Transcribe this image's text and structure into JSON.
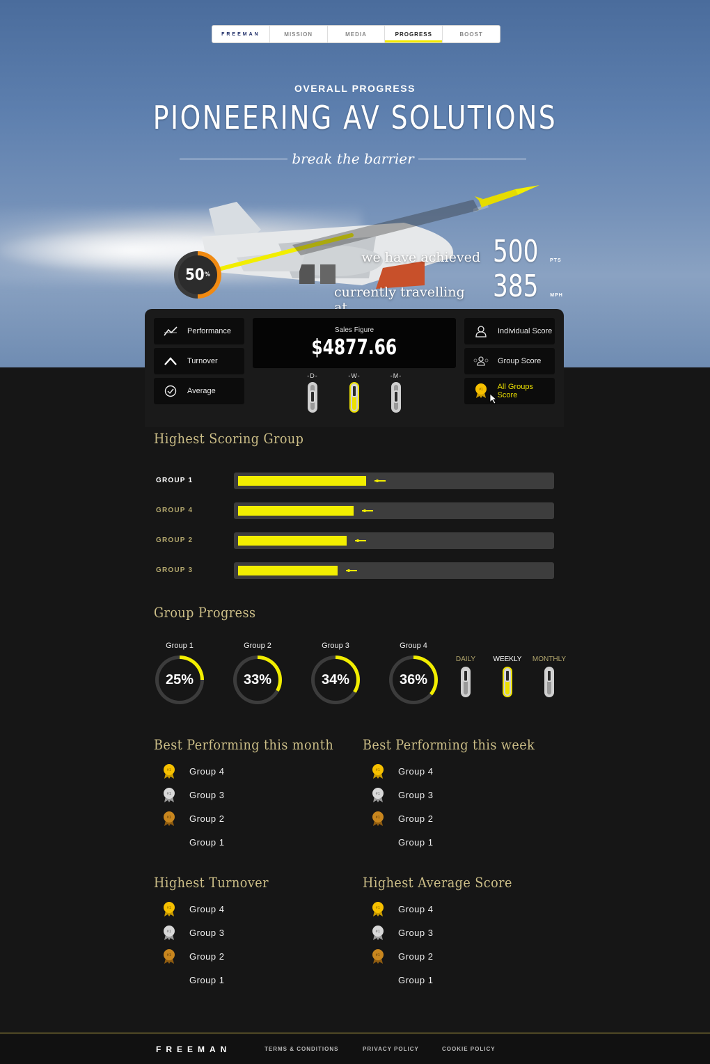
{
  "nav": {
    "brand": "FREEMAN",
    "items": [
      "MISSION",
      "MEDIA",
      "PROGRESS",
      "BOOST"
    ],
    "active": "PROGRESS"
  },
  "hero": {
    "eyebrow": "OVERALL PROGRESS",
    "headline": "PIONEERING AV SOLUTIONS",
    "tagline": "break the barrier",
    "progress_percent": "50",
    "progress_unit": "%",
    "achieved_label": "we have achieved",
    "achieved_value": "500",
    "achieved_unit": "PTS",
    "travelling_label": "currently travelling at",
    "travelling_value": "385",
    "travelling_unit": "MPH"
  },
  "panel": {
    "left_buttons": [
      "Performance",
      "Turnover",
      "Average"
    ],
    "right_buttons": [
      "Individual Score",
      "Group Score",
      "All Groups Score"
    ],
    "sales_label": "Sales Figure",
    "sales_value": "$4877.66",
    "toggles": [
      {
        "label": "-D-",
        "on": false
      },
      {
        "label": "-W-",
        "on": true
      },
      {
        "label": "-M-",
        "on": false
      }
    ],
    "medal_text": "#1"
  },
  "highest_scoring": {
    "title": "Highest Scoring Group",
    "groups": [
      {
        "label": "GROUP 1",
        "fill": 0.4
      },
      {
        "label": "GROUP 4",
        "fill": 0.36
      },
      {
        "label": "GROUP 2",
        "fill": 0.34
      },
      {
        "label": "GROUP 3",
        "fill": 0.31
      }
    ]
  },
  "group_progress": {
    "title": "Group Progress",
    "groups": [
      {
        "label": "Group 1",
        "value": "25%",
        "percent": 25
      },
      {
        "label": "Group 2",
        "value": "33%",
        "percent": 33
      },
      {
        "label": "Group 3",
        "value": "34%",
        "percent": 34
      },
      {
        "label": "Group 4",
        "value": "36%",
        "percent": 36
      }
    ],
    "periods": [
      {
        "label": "DAILY",
        "on": false
      },
      {
        "label": "WEEKLY",
        "on": true
      },
      {
        "label": "MONTHLY",
        "on": false
      }
    ]
  },
  "rankings": [
    {
      "title": "Best Performing this month",
      "items": [
        "Group 4",
        "Group 3",
        "Group 2",
        "Group 1"
      ]
    },
    {
      "title": "Best Performing this week",
      "items": [
        "Group 4",
        "Group 3",
        "Group 2",
        "Group 1"
      ]
    },
    {
      "title": "Highest Turnover",
      "items": [
        "Group 4",
        "Group 3",
        "Group 2",
        "Group 1"
      ]
    },
    {
      "title": "Highest Average Score",
      "items": [
        "Group 4",
        "Group 3",
        "Group 2",
        "Group 1"
      ]
    }
  ],
  "footer": {
    "brand": "FREEMAN",
    "links": [
      "TERMS & CONDITIONS",
      "PRIVACY POLICY",
      "COOKIE POLICY"
    ]
  },
  "colors": {
    "accent": "#f2ee00",
    "gold_text": "#cdbf88",
    "meter": "#f08a12",
    "bg": "#161616"
  }
}
